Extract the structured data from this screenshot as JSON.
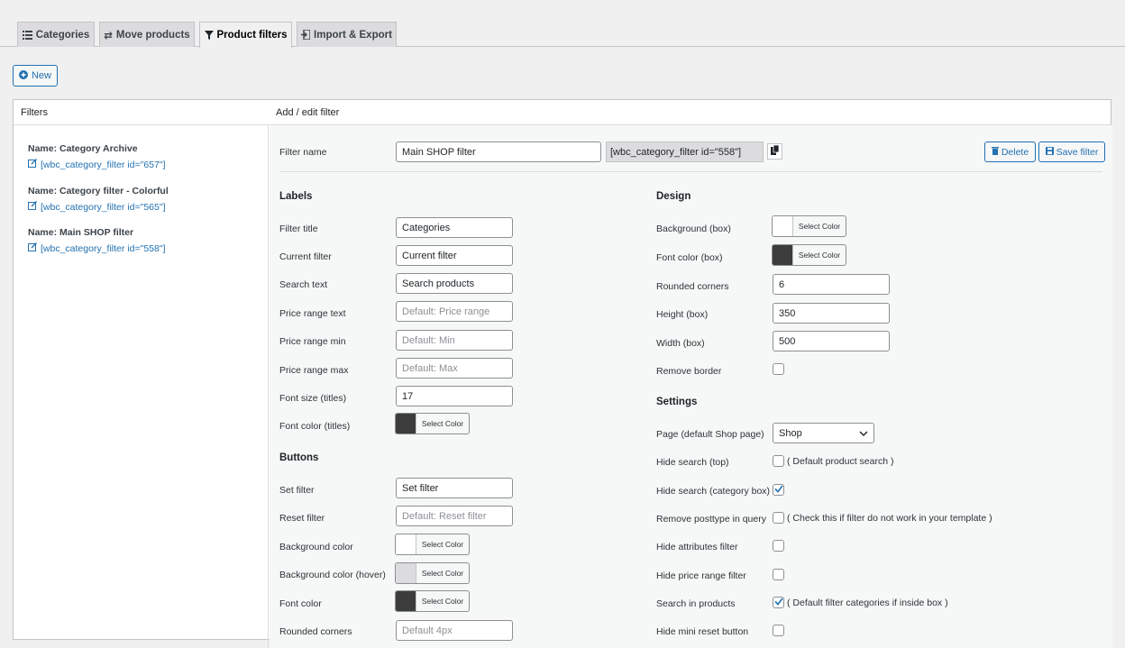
{
  "tabs": [
    {
      "label": "Categories",
      "icon": "list-icon"
    },
    {
      "label": "Move products",
      "icon": "arrows-icon"
    },
    {
      "label": "Product filters",
      "icon": "filter-icon",
      "active": true
    },
    {
      "label": "Import & Export",
      "icon": "import-icon"
    }
  ],
  "new_button": {
    "label": "New"
  },
  "panels": {
    "filters_title": "Filters",
    "editor_title": "Add / edit filter"
  },
  "filters": [
    {
      "name": "Name: Category Archive",
      "shortcode": "[wbc_category_filter id=\"657\"]"
    },
    {
      "name": "Name: Category filter - Colorful",
      "shortcode": "[wbc_category_filter id=\"565\"]"
    },
    {
      "name": "Name: Main SHOP filter",
      "shortcode": "[wbc_category_filter id=\"558\"]"
    }
  ],
  "editor": {
    "filter_name_label": "Filter name",
    "filter_name_value": "Main SHOP filter",
    "shortcode": "[wbc_category_filter id=\"558\"]",
    "delete_label": "Delete",
    "save_label": "Save filter",
    "select_color_label": "Select Color"
  },
  "labels_section": {
    "title": "Labels",
    "rows": [
      {
        "label": "Filter title",
        "value": "Categories",
        "placeholder": ""
      },
      {
        "label": "Current filter",
        "value": "Current filter",
        "placeholder": ""
      },
      {
        "label": "Search text",
        "value": "Search products",
        "placeholder": ""
      },
      {
        "label": "Price range text",
        "value": "",
        "placeholder": "Default: Price range"
      },
      {
        "label": "Price range min",
        "value": "",
        "placeholder": "Default: Min"
      },
      {
        "label": "Price range max",
        "value": "",
        "placeholder": "Default: Max"
      },
      {
        "label": "Font size (titles)",
        "value": "17",
        "placeholder": ""
      },
      {
        "label": "Font color (titles)",
        "color": "#3c3c3c"
      }
    ]
  },
  "buttons_section": {
    "title": "Buttons",
    "rows": [
      {
        "label": "Set filter",
        "value": "Set filter",
        "placeholder": ""
      },
      {
        "label": "Reset filter",
        "value": "",
        "placeholder": "Default: Reset filter"
      },
      {
        "label": "Background color",
        "color": "#ffffff"
      },
      {
        "label": "Background color (hover)",
        "color": "#dcdcde"
      },
      {
        "label": "Font color",
        "color": "#3c3c3c"
      },
      {
        "label": "Rounded corners",
        "value": "",
        "placeholder": "Default 4px"
      }
    ]
  },
  "design_section": {
    "title": "Design",
    "rows": [
      {
        "label": "Background (box)",
        "color": "#ffffff"
      },
      {
        "label": "Font color (box)",
        "color": "#3c3c3c"
      },
      {
        "label": "Rounded corners",
        "value": "6"
      },
      {
        "label": "Height (box)",
        "value": "350"
      },
      {
        "label": "Width (box)",
        "value": "500"
      },
      {
        "label": "Remove border",
        "checked": false
      }
    ]
  },
  "settings_section": {
    "title": "Settings",
    "page_label": "Page (default Shop page)",
    "page_value": "Shop",
    "rows": [
      {
        "label": "Hide search (top)",
        "checked": false,
        "note": "( Default product search )"
      },
      {
        "label": "Hide search (category box)",
        "checked": true,
        "note": ""
      },
      {
        "label": "Remove posttype in query",
        "checked": false,
        "note": "( Check this if filter do not work in your template )"
      },
      {
        "label": "Hide attributes filter",
        "checked": false,
        "note": ""
      },
      {
        "label": "Hide price range filter",
        "checked": false,
        "note": ""
      },
      {
        "label": "Search in products",
        "checked": true,
        "note": "( Default filter categories if inside box )"
      },
      {
        "label": "Hide mini reset button",
        "checked": false,
        "note": ""
      }
    ]
  },
  "colors": {
    "accent": "#2271b1",
    "dark_swatch": "#3c3c3c"
  }
}
